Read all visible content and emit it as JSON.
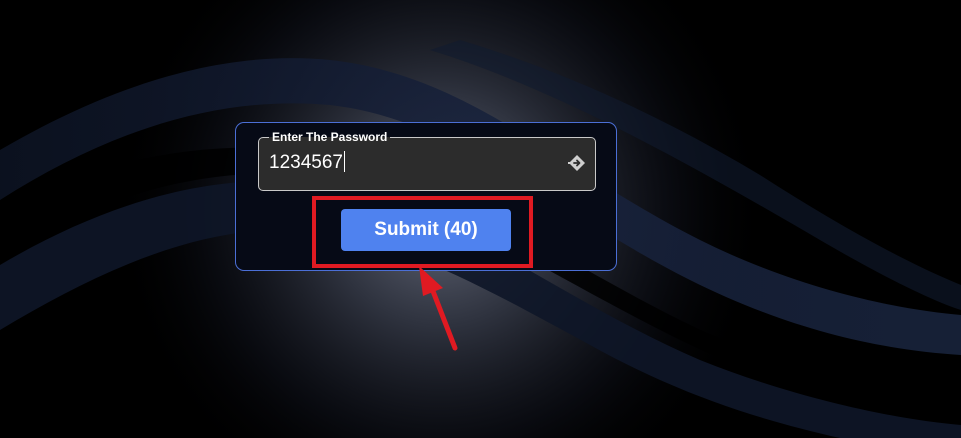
{
  "password_form": {
    "legend": "Enter The Password",
    "input_value": "1234567",
    "reveal_icon": "password-action-icon"
  },
  "submit": {
    "label": "Submit (40)"
  },
  "annotation": {
    "highlight_color": "#e01a22",
    "arrow_color": "#e01a22"
  },
  "colors": {
    "panel_border": "#4b6fd6",
    "button_bg": "#4f82ef",
    "background": "#000000"
  }
}
